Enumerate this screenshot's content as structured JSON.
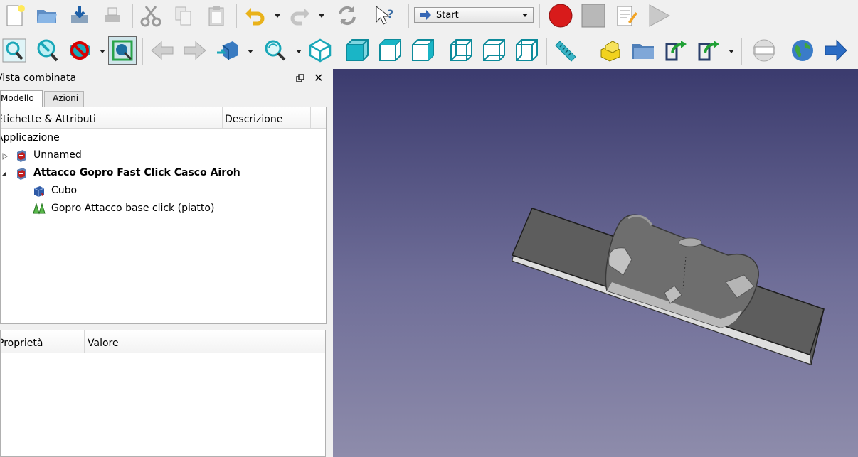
{
  "toolbar": {
    "macro_combo_value": "Start",
    "row1_icons": [
      "new-document-icon",
      "open-folder-icon",
      "save-icon",
      "print-icon",
      "cut-icon",
      "copy-icon",
      "paste-icon",
      "undo-icon",
      "redo-icon",
      "refresh-icon",
      "whats-this-icon",
      "record-macro-icon",
      "stop-macro-icon",
      "edit-macro-icon",
      "run-macro-icon"
    ],
    "row2_icons": [
      "fit-all-icon",
      "fit-selection-icon",
      "draw-style-icon",
      "bounding-box-icon",
      "back-icon",
      "forward-icon",
      "sync-view-icon",
      "std-views-icon",
      "isometric-view-icon",
      "front-view-icon",
      "top-view-icon",
      "right-view-icon",
      "rear-view-icon",
      "bottom-view-icon",
      "left-view-icon",
      "measure-icon",
      "part-icon",
      "group-icon",
      "link-icon",
      "link-actions-icon",
      "web-placeholder-icon",
      "web-globe-icon",
      "next-icon"
    ]
  },
  "panel": {
    "title": "Vista combinata",
    "tabs": [
      {
        "label": "Modello"
      },
      {
        "label": "Azioni"
      }
    ],
    "tree": {
      "col_labels": "Etichette & Attributi",
      "col_description": "Descrizione",
      "root": "Applicazione",
      "items": [
        {
          "label": "Unnamed",
          "bold": false
        },
        {
          "label": "Attacco Gopro Fast Click Casco Airoh",
          "bold": true
        },
        {
          "label": "Cubo",
          "bold": false
        },
        {
          "label": "Gopro Attacco base click (piatto)",
          "bold": false
        }
      ]
    },
    "properties": {
      "col_property": "Proprietà",
      "col_value": "Valore"
    }
  },
  "colors": {
    "view_top": "#3b3b6e",
    "view_bottom": "#8e8cab",
    "accent_teal": "#1aa7b8",
    "record_red": "#d81b1b"
  }
}
